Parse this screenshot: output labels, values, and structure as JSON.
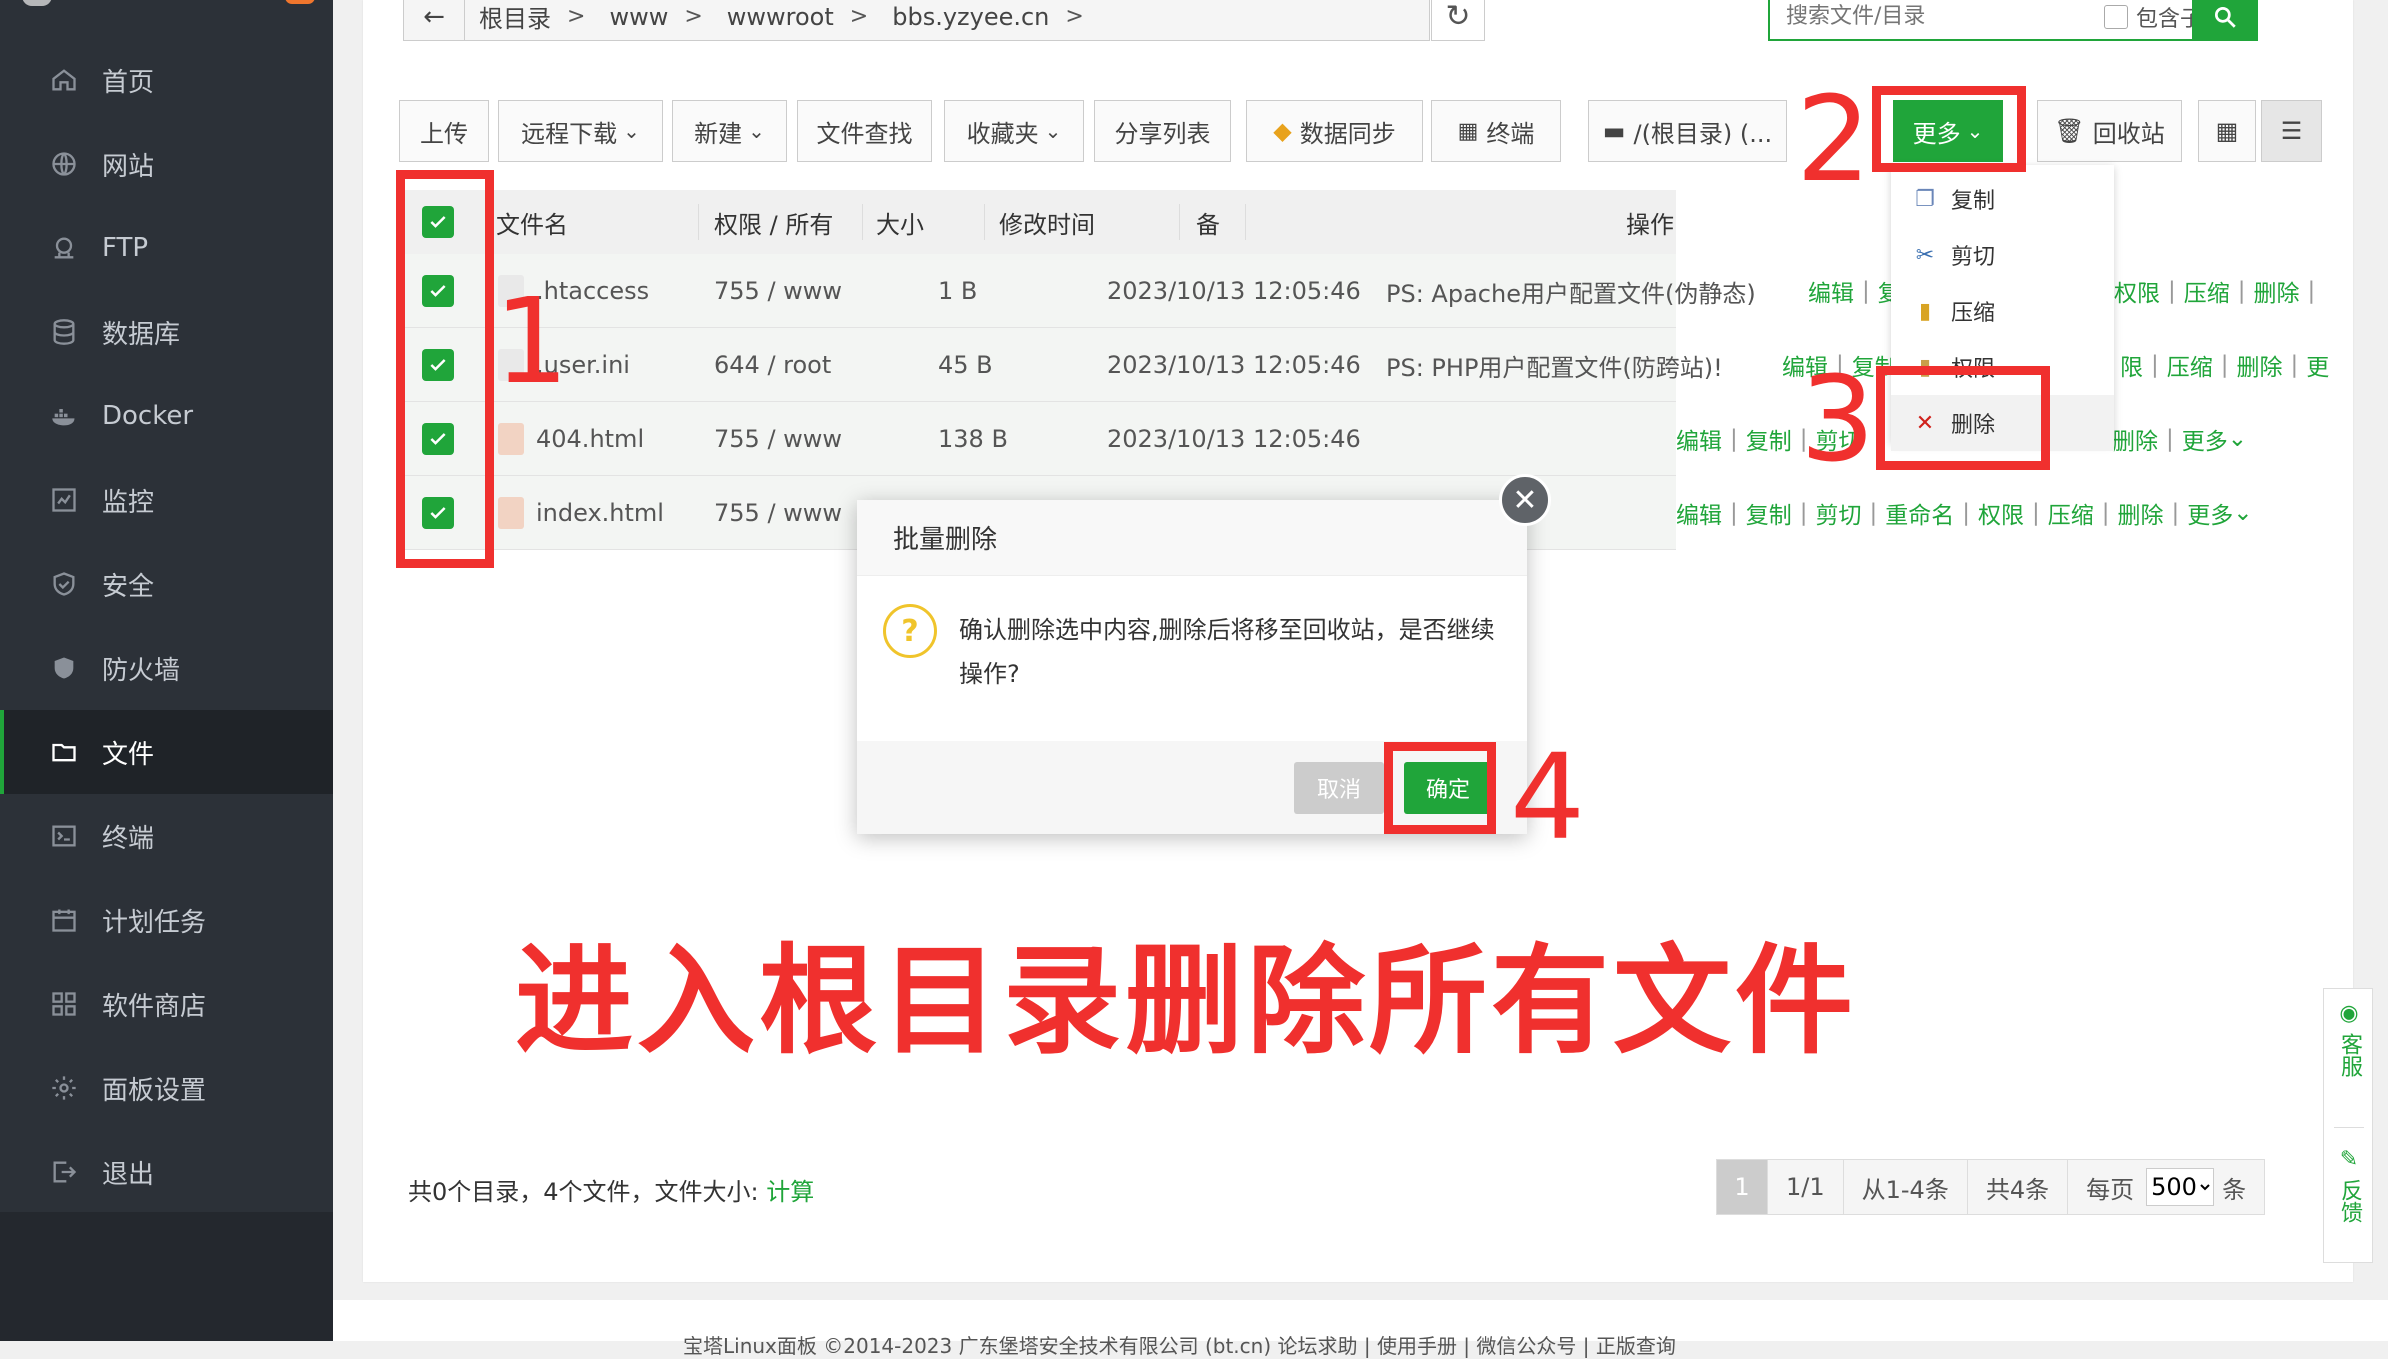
{
  "sidebar": {
    "items": [
      {
        "label": "首页",
        "icon": "home-icon"
      },
      {
        "label": "网站",
        "icon": "globe-icon"
      },
      {
        "label": "FTP",
        "icon": "ftp-icon"
      },
      {
        "label": "数据库",
        "icon": "database-icon"
      },
      {
        "label": "Docker",
        "icon": "docker-icon"
      },
      {
        "label": "监控",
        "icon": "monitor-icon"
      },
      {
        "label": "安全",
        "icon": "shield-icon"
      },
      {
        "label": "防火墙",
        "icon": "firewall-icon"
      },
      {
        "label": "文件",
        "icon": "folder-icon",
        "active": true
      },
      {
        "label": "终端",
        "icon": "terminal-icon"
      },
      {
        "label": "计划任务",
        "icon": "calendar-icon"
      },
      {
        "label": "软件商店",
        "icon": "apps-icon"
      },
      {
        "label": "面板设置",
        "icon": "gear-icon"
      },
      {
        "label": "退出",
        "icon": "logout-icon"
      }
    ]
  },
  "breadcrumb": {
    "segments": [
      "根目录",
      "www",
      "wwwroot",
      "bbs.yzyee.cn"
    ]
  },
  "search": {
    "placeholder": "搜索文件/目录",
    "include_sub_label": "包含子目录"
  },
  "toolbar": {
    "upload": "上传",
    "remote_download": "远程下载",
    "new": "新建",
    "file_search": "文件查找",
    "favorites": "收藏夹",
    "share_list": "分享列表",
    "data_sync": "数据同步",
    "terminal": "终端",
    "disk": "/(根目录) (...",
    "more": "更多",
    "recycle": "回收站"
  },
  "table": {
    "headers": {
      "name": "文件名",
      "perm": "权限 / 所有",
      "size": "大小",
      "mtime": "修改时间",
      "note": "备",
      "ops": "操作"
    },
    "rows": [
      {
        "name": ".htaccess",
        "perm": "755 / www",
        "size": "1 B",
        "mtime": "2023/10/13 12:05:46",
        "note": "PS: Apache用户配置文件(伪静态)"
      },
      {
        "name": ".user.ini",
        "perm": "644 / root",
        "size": "45 B",
        "mtime": "2023/10/13 12:05:46",
        "note": "PS: PHP用户配置文件(防跨站)!"
      },
      {
        "name": "404.html",
        "perm": "755 / www",
        "size": "138 B",
        "mtime": "2023/10/13 12:05:46",
        "note": ""
      },
      {
        "name": "index.html",
        "perm": "755 / www",
        "size": "",
        "mtime": "",
        "note": ""
      }
    ],
    "ops": {
      "edit": "编辑",
      "copy": "复制",
      "cut": "剪切",
      "rename": "重命名",
      "perm": "权限",
      "compress": "压缩",
      "delete": "删除",
      "more": "更多"
    },
    "row1_ops_tail": [
      "编辑",
      "复",
      "权限",
      "压缩",
      "删除",
      "|"
    ],
    "row2_ops_tail": [
      "编辑",
      "复制",
      "限",
      "压缩",
      "删除",
      "更"
    ],
    "row3_ops": [
      "编辑",
      "复制",
      "剪切",
      "删除",
      "更多"
    ],
    "row4_ops": [
      "编辑",
      "复制",
      "剪切",
      "重命名",
      "权限",
      "压缩",
      "删除",
      "更多"
    ]
  },
  "dropdown": {
    "items": [
      {
        "label": "复制",
        "icon": "copy-icon"
      },
      {
        "label": "剪切",
        "icon": "scissors-icon"
      },
      {
        "label": "压缩",
        "icon": "zip-icon"
      },
      {
        "label": "权限",
        "icon": "lock-icon"
      },
      {
        "label": "删除",
        "icon": "x-icon"
      }
    ]
  },
  "dialog": {
    "title": "批量删除",
    "message": "确认删除选中内容,删除后将移至回收站，是否继续操作?",
    "cancel": "取消",
    "confirm": "确定"
  },
  "annotations": {
    "n1": "1",
    "n2": "2",
    "n3": "3",
    "n4": "4",
    "caption": "进入根目录删除所有文件"
  },
  "summary": {
    "text": "共0个目录，4个文件，文件大小:",
    "calc_link": "计算"
  },
  "pager": {
    "current": "1",
    "pages": "1/1",
    "range": "从1-4条",
    "total": "共4条",
    "per_page_label": "每页",
    "per_page_value": "500",
    "unit": "条"
  },
  "side_float": {
    "service": "客服",
    "feedback": "反馈"
  },
  "footer": {
    "text": "宝塔Linux面板 ©2014-2023 广东堡塔安全技术有限公司 (bt.cn)   论坛求助  |  使用手册  |  微信公众号  |  正版查询"
  },
  "colors": {
    "accent": "#20a53a",
    "annotation": "#f0302e",
    "sidebar_bg": "#2c3138"
  }
}
